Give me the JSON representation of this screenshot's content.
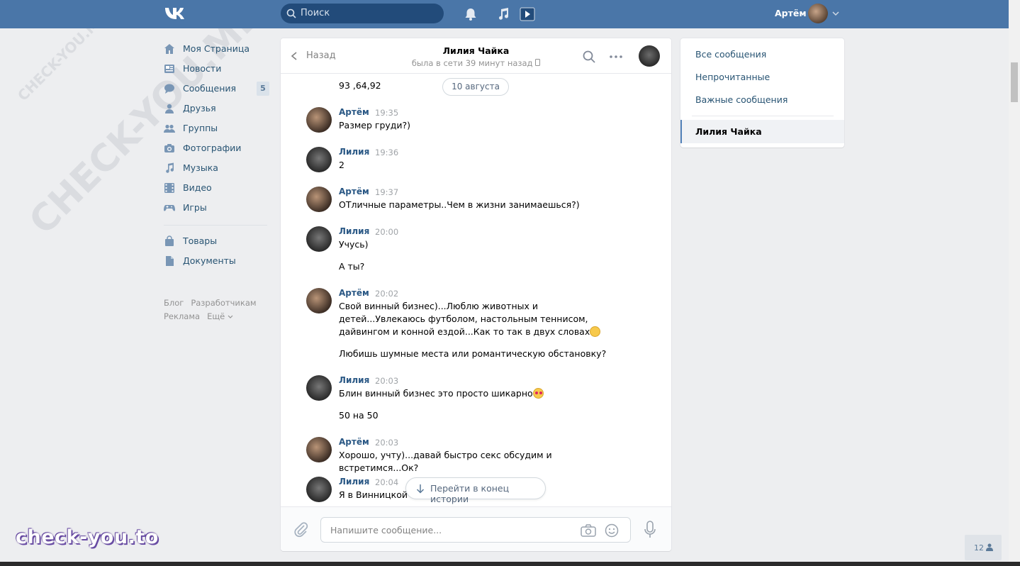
{
  "header": {
    "logo_icon": "vk-logo-icon",
    "search_placeholder": "Поиск",
    "user_name": "Артём",
    "icons": [
      "bell-icon",
      "music-icon",
      "video-play-icon"
    ]
  },
  "sidebar": {
    "items": [
      {
        "label": "Моя Страница",
        "icon": "home-icon"
      },
      {
        "label": "Новости",
        "icon": "news-icon"
      },
      {
        "label": "Сообщения",
        "icon": "messages-icon",
        "badge": "5"
      },
      {
        "label": "Друзья",
        "icon": "friends-icon"
      },
      {
        "label": "Группы",
        "icon": "groups-icon"
      },
      {
        "label": "Фотографии",
        "icon": "camera-icon"
      },
      {
        "label": "Музыка",
        "icon": "music-icon"
      },
      {
        "label": "Видео",
        "icon": "film-icon"
      },
      {
        "label": "Игры",
        "icon": "gamepad-icon"
      }
    ],
    "items2": [
      {
        "label": "Товары",
        "icon": "bag-icon"
      },
      {
        "label": "Документы",
        "icon": "document-icon"
      }
    ],
    "footer": {
      "blog": "Блог",
      "dev": "Разработчикам",
      "ads": "Реклама",
      "more": "Ещё"
    }
  },
  "chat": {
    "back_label": "Назад",
    "peer_name": "Лилия Чайка",
    "peer_status": "была в сети 39 минут назад",
    "date_pill": "10 августа",
    "top_fragment": "93 ,64,92",
    "messages": [
      {
        "author": "Артём",
        "time": "19:35",
        "lines": [
          "Размер груди?)"
        ]
      },
      {
        "author": "Лилия",
        "time": "19:36",
        "lines": [
          "2"
        ]
      },
      {
        "author": "Артём",
        "time": "19:37",
        "lines": [
          "ОТличные параметры..Чем в жизни занимаешься?)"
        ]
      },
      {
        "author": "Лилия",
        "time": "20:00",
        "lines": [
          "Учусь)",
          "А ты?"
        ]
      },
      {
        "author": "Артём",
        "time": "20:02",
        "lines": [
          "Свой винный бизнес)...Люблю животных и детей...Увлекаюсь футболом, настольным теннисом, дайвингом и конной ездой...Как то так в двух словах",
          "Любишь шумные места или романтическую обстановку?"
        ]
      },
      {
        "author": "Лилия",
        "time": "20:03",
        "lines": [
          "Блин винный бизнес это просто шикарно",
          "50 на 50"
        ]
      },
      {
        "author": "Артём",
        "time": "20:03",
        "lines": [
          "Хорошо, учту)...давай быстро секс обсудим и встретимся...Ок?"
        ]
      },
      {
        "author": "Лилия",
        "time": "20:04",
        "lines": [
          "Я в Винницкой о"
        ]
      }
    ],
    "jump_label": "Перейти в конец истории",
    "composer_placeholder": "Напишите сообщение..."
  },
  "right_panel": {
    "all": "Все сообщения",
    "unread": "Непрочитанные",
    "important": "Важные сообщения",
    "active": "Лилия Чайка"
  },
  "online_count": "12",
  "watermark": "check-you.to",
  "watermark_diag": "CHECK-YOU.ME",
  "colors": {
    "header": "#4a76a8",
    "link": "#285473",
    "author": "#2a5885"
  }
}
